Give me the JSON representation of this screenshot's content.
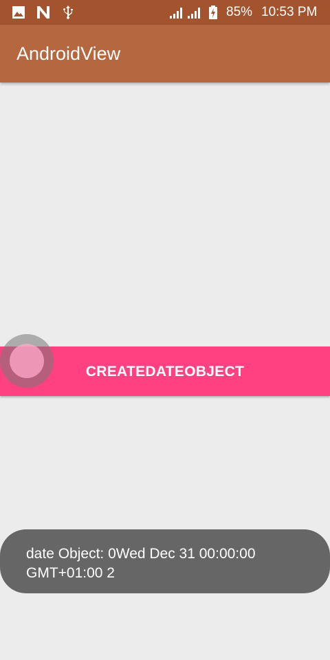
{
  "status_bar": {
    "battery": "85%",
    "time": "10:53 PM",
    "icons": [
      "image-icon",
      "n-notification-icon",
      "usb-icon",
      "signal-sim1-icon",
      "signal-sim2-icon",
      "battery-charging-icon"
    ]
  },
  "app_bar": {
    "title": "AndroidView"
  },
  "main": {
    "button_label": "CREATEDATEOBJECT"
  },
  "toast": {
    "line1": "date Object: 0Wed Dec 31 00:00:00",
    "line2": "GMT+01:00 2"
  },
  "colors": {
    "status_bar": "#a3542e",
    "app_bar": "#b5683f",
    "background": "#ececec",
    "button": "#ff4081",
    "toast": "#666666"
  }
}
